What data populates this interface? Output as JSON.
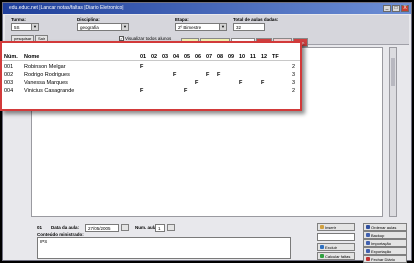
{
  "window": {
    "title": "edu.educ.net   |Lancar notas/faltas   |Diario Eletronico|",
    "buttons": [
      "_",
      "□",
      "X"
    ]
  },
  "toolbar": {
    "turma_label": "Turma:",
    "turma_value": "5S",
    "disciplina_label": "Disciplina:",
    "disciplina_value": "geografia",
    "etapa_label": "Etapa:",
    "etapa_value": "2º Bimestre",
    "total_label": "Total de aulas dadas:",
    "total_value": "32",
    "pesquisar_label": "pesquisar",
    "sair_label": "Sair",
    "visualizar_label": "Visualizar todos alunos",
    "visualizar_checked": "✓",
    "legend": [
      "Repet.",
      "Rem. p/ Rem.",
      "Em Curso",
      "Evad.",
      "Transf.",
      "Disp."
    ]
  },
  "grid": {
    "headers": {
      "num": "Núm.",
      "nome": "Nome",
      "days": [
        "01",
        "02",
        "03",
        "04",
        "05",
        "06",
        "07",
        "08",
        "09",
        "10",
        "11",
        "12",
        "TF"
      ]
    },
    "rows": [
      {
        "num": "001",
        "name": "Robinson Melgar",
        "marks": [
          "F",
          "",
          "",
          "",
          "",
          "",
          "",
          "",
          "",
          "",
          "",
          "",
          ""
        ],
        "tf": "2"
      },
      {
        "num": "002",
        "name": "Rodrigo Rodrigues",
        "marks": [
          "",
          "",
          "",
          "F",
          "",
          "",
          "F",
          "F",
          "",
          "",
          "",
          "",
          ""
        ],
        "tf": "3"
      },
      {
        "num": "003",
        "name": "Vanessa Marques",
        "marks": [
          "",
          "",
          "",
          "",
          "",
          "F",
          "",
          "",
          "",
          "F",
          "",
          "F",
          ""
        ],
        "tf": "3"
      },
      {
        "num": "004",
        "name": "Vinicius Casagrande",
        "marks": [
          "F",
          "",
          "",
          "",
          "F",
          "",
          "",
          "",
          "",
          "",
          "",
          "",
          ""
        ],
        "tf": "2"
      }
    ]
  },
  "bottom": {
    "aula_number": "01",
    "data_label": "Data da aula:",
    "data_value": "27/05/2005",
    "num_aula_label": "Num. aula:",
    "num_aula_value": "1",
    "conteudo_label": "Conteúdo ministrado:",
    "conteudo_value": "IPS"
  },
  "actions": {
    "inserir": "Inserir",
    "excluir": "Excluir",
    "calcular": "Calcular faltas",
    "ordenar": "Ordenar aulas",
    "backup": "Backup",
    "importacao": "Importação",
    "exportacao": "Exportação",
    "fechar": "Fechar Diário"
  },
  "colors": {
    "titlebar": "#1e3e9a",
    "highlight_border": "#d23a3a",
    "legend_evad": "#d04040",
    "legend_transf": "#e06060"
  }
}
